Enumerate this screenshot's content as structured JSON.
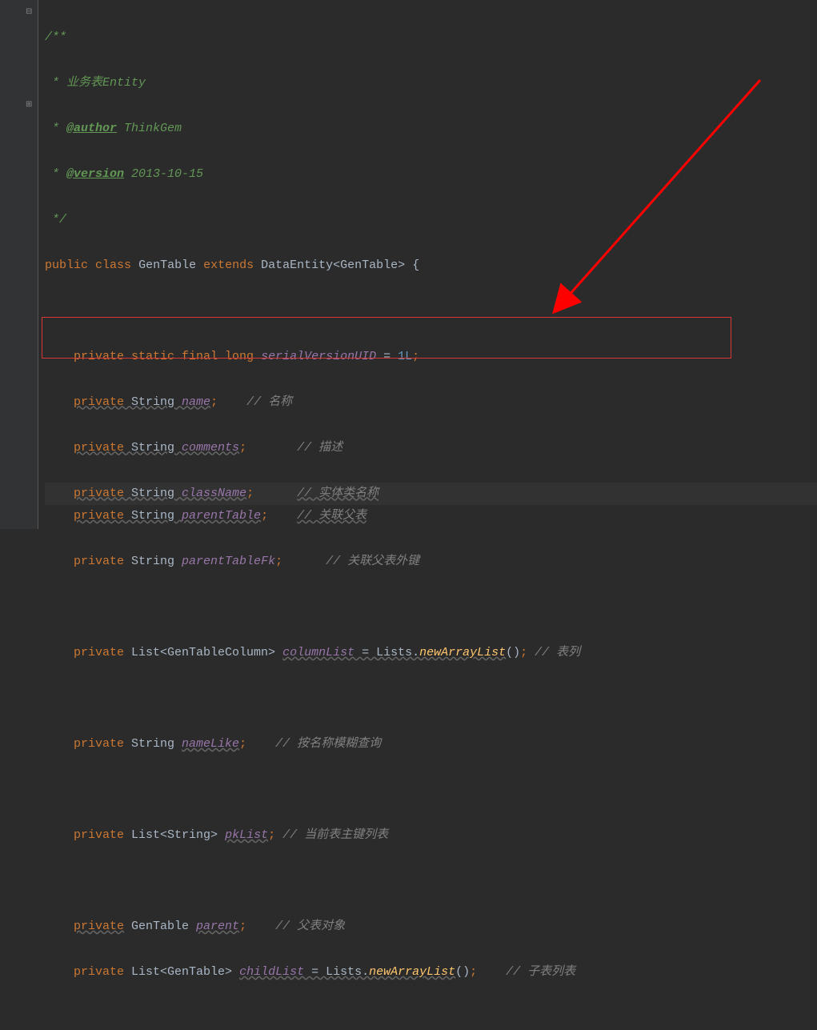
{
  "doc": {
    "open": "/**",
    "line1": " * 业务表Entity",
    "authorTag": "@author",
    "authorName": " ThinkGem",
    "versionTag": "@version",
    "versionVal": " 2013-10-15",
    "close": " */"
  },
  "class": {
    "public": "public",
    "classKw": "class",
    "name": "GenTable",
    "extends": "extends",
    "parent": "DataEntity",
    "generic": "GenTable",
    "brace": "{"
  },
  "f1": {
    "mods": "private static final long ",
    "name": "serialVersionUID",
    "eq": " = ",
    "val": "1L",
    "semi": ";"
  },
  "f2": {
    "priv": "private",
    "type": " String ",
    "name": "name",
    "semi": ";",
    "comment": "// 名称"
  },
  "f3": {
    "priv": "private",
    "type": " String ",
    "name": "comments",
    "semi": ";",
    "comment": "// 描述"
  },
  "f4": {
    "priv": "private",
    "type": " String ",
    "name": "className",
    "semi": ";",
    "comment": "// 实体类名称"
  },
  "f5": {
    "priv": "private",
    "type": " String ",
    "name": "parentTable",
    "semi": ";",
    "comment": "// 关联父表"
  },
  "f6": {
    "priv": "private",
    "type": " String ",
    "name": "parentTableFk",
    "semi": ";",
    "comment": "// 关联父表外键"
  },
  "f7": {
    "priv": "private",
    "type1": " List<GenTableColumn> ",
    "name": "columnList",
    "eq": " = Lists.",
    "method": "newArrayList",
    "call": "()",
    "semi": ";",
    "comment": " // 表列"
  },
  "f8": {
    "priv": "private",
    "type": " String ",
    "name": "nameLike",
    "semi": ";",
    "comment": "// 按名称模糊查询"
  },
  "f9": {
    "priv": "private",
    "type": " List<String> ",
    "name": "pkList",
    "semi": ";",
    "comment": " // 当前表主键列表"
  },
  "f10": {
    "priv": "private",
    "type": " GenTable ",
    "name": "parent",
    "semi": ";",
    "comment": "// 父表对象"
  },
  "f11": {
    "priv": "private",
    "type": " List<GenTable> ",
    "name": "childList",
    "eq": " = Lists.",
    "method": "newArrayList",
    "call": "()",
    "semi": ";",
    "comment": "// 子表列表"
  },
  "icons": {
    "collapse": "⊟",
    "expand": "⊞"
  }
}
